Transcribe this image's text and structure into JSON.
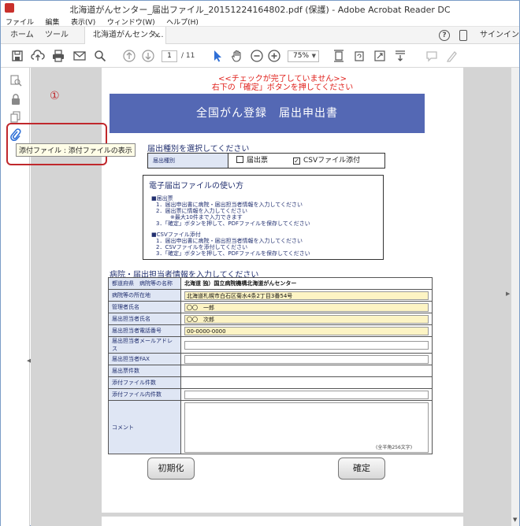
{
  "window": {
    "title": "北海道がんセンター_届出ファイル_20151224164802.pdf (保護) - Adobe Acrobat Reader DC"
  },
  "menu": [
    "ファイル",
    "編集",
    "表示(V)",
    "ウィンドウ(W)",
    "ヘルプ(H)"
  ],
  "tabs": {
    "home": "ホーム",
    "tools": "ツール",
    "document": "北海道がんセンタ...",
    "close": "×",
    "signin": "サインイン",
    "help": "?"
  },
  "toolbar": {
    "page_current": "1",
    "page_total": "/ 11",
    "zoom": "75%"
  },
  "left_panel": {
    "tooltip": "添付ファイル : 添付ファイルの表示",
    "annotation_number": "①"
  },
  "document": {
    "warning_line1": "<<チェックが完了していません>>",
    "warning_line2": "右下の「確定」ボタンを押してください",
    "banner_title": "全国がん登録　届出申出書",
    "type_section_title": "届出種別を選択してください",
    "type_label": "届出種別",
    "option_sheet": "届出票",
    "option_csv": "CSVファイル添付",
    "option_csv_checked": "✓",
    "usage_title": "電子届出ファイルの使い方",
    "usage_lines": [
      "■届出票",
      "1．届出申出書に病院・届出担当者情報を入力してください",
      "2．届出票に情報を入力してください",
      "※最大10件まで入力できます",
      "3．「確定」ボタンを押して、PDFファイルを保存してください",
      "■CSVファイル添付",
      "1．届出申出書に病院・届出担当者情報を入力してください",
      "2．CSVファイルを添付してください",
      "3．「確定」ボタンを押して、PDFファイルを保存してください"
    ],
    "info_section_title": "病院・届出担当者情報を入力してください",
    "rows": [
      {
        "label": "都道府県　病院等の名称",
        "value": "北海道 独）国立病院機構北海道がんセンター",
        "style": "plain-text"
      },
      {
        "label": "病院等の所在地",
        "value": "北海道札幌市白石区菊水4条2丁目3番54号",
        "style": "fill"
      },
      {
        "label": "管理者氏名",
        "value": "〇〇　一郎",
        "style": "fill"
      },
      {
        "label": "届出担当者氏名",
        "value": "〇〇　次郎",
        "style": "fill"
      },
      {
        "label": "届出担当者電話番号",
        "value": "00-0000-0000",
        "style": "fill"
      },
      {
        "label": "届出担当者メールアドレス",
        "value": "",
        "style": "empty"
      },
      {
        "label": "届出担当者FAX",
        "value": "",
        "style": "empty"
      },
      {
        "label": "届出票件数",
        "value": "",
        "style": "none"
      },
      {
        "label": "添付ファイル件数",
        "value": "",
        "style": "none"
      },
      {
        "label": "添付ファイル内件数",
        "value": "",
        "style": "empty"
      }
    ],
    "comment_label": "コメント",
    "comment_note": "(全半角256文字)",
    "reset_button": "初期化",
    "confirm_button": "確定"
  }
}
